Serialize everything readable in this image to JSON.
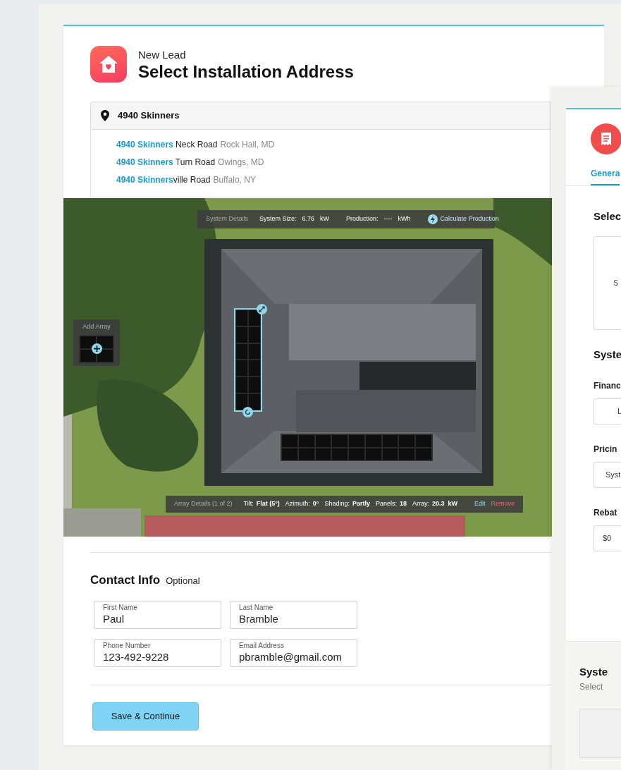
{
  "header": {
    "overline": "New Lead",
    "title": "Select Installation Address"
  },
  "address_search": {
    "value": "4940 Skinners"
  },
  "suggestions": [
    {
      "address": "**4940 Skinners** Neck Road",
      "city": "Rock Hall, MD"
    },
    {
      "address": "**4940 Skinners** Turn Road",
      "city": "Owings, MD"
    },
    {
      "address": "**4940 Skinners**ville Road",
      "city": "Buffalo, NY"
    }
  ],
  "map": {
    "system_bar": {
      "label": "System Details",
      "size_label": "System Size:",
      "size_value": "6.76",
      "size_unit": "kW",
      "production_label": "Production:",
      "production_value": "----",
      "production_unit": "kWh",
      "action": "Calculate Production"
    },
    "add_array": {
      "label": "Add Array"
    },
    "arrays": [
      {
        "kind": "column",
        "selected": true
      },
      {
        "kind": "row",
        "selected": false
      }
    ],
    "array_bar": {
      "label": "Array Details (1 of 2)",
      "fields": [
        {
          "label": "Tilt:",
          "value": "Flat (5°)"
        },
        {
          "label": "Azimuth:",
          "value": "0°"
        },
        {
          "label": "Shading:",
          "value": "Partly"
        },
        {
          "label": "Panels:",
          "value": "18"
        },
        {
          "label": "Array:",
          "value": "20.3  kW"
        }
      ],
      "edit": "Edit",
      "remove": "Remove"
    }
  },
  "contact": {
    "title": "Contact Info",
    "hint": "Optional",
    "fields": [
      {
        "label": "First Name",
        "value": "Paul"
      },
      {
        "label": "Last Name",
        "value": "Bramble"
      },
      {
        "label": "Phone Number",
        "value": "123-492-9228"
      },
      {
        "label": "Email Address",
        "value": "pbramble@gmail.com"
      }
    ]
  },
  "save_button": "Save & Continue",
  "side_card": {
    "tabs": [
      {
        "label": "Genera",
        "selected": true
      }
    ],
    "section_title": "Selec",
    "option_text": "S",
    "system_title": "Syste",
    "fields": [
      {
        "label": "Financ",
        "value": "L",
        "kind": "button"
      },
      {
        "label": "Pricin",
        "value": "Syst",
        "kind": "select"
      },
      {
        "label": "Rebat",
        "value": "$0",
        "kind": "input"
      }
    ],
    "footer": {
      "title": "Syste",
      "subtitle": "Select"
    }
  }
}
